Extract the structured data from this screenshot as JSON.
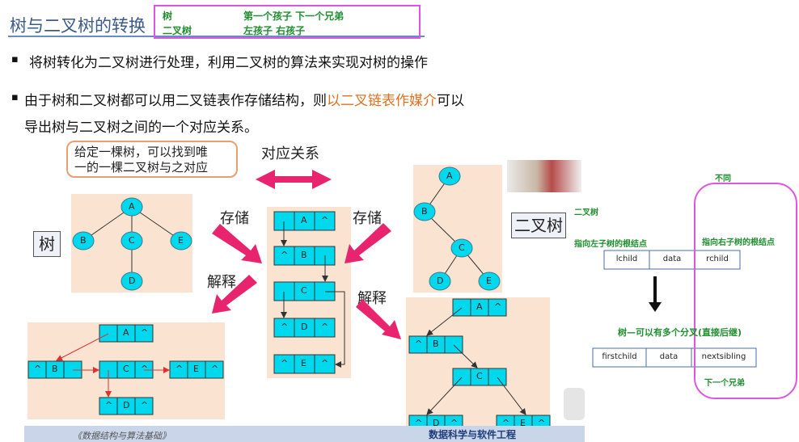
{
  "title": "树与二叉树的转换",
  "note": {
    "r1c1": "树",
    "r1c2": "第一个孩子 下一个兄弟",
    "r2c1": "二叉树",
    "r2c2": "左孩子 右孩子"
  },
  "bullets": {
    "b1": "将树转化为二叉树进行处理，利用二叉树的算法来实现对树的操作",
    "b2_a": "由于树和二叉树都可以用二叉链表作存储结构，则",
    "b2_hl": "以二叉链表作媒介",
    "b2_b": "可以",
    "b2_c": "导出树与二叉树之间的一个对应关系。",
    "bullet_glyph": "▪"
  },
  "diagram": {
    "callout_l1": "给定一棵树，可以找到唯",
    "callout_l2": "一的一棵二叉树与之对应",
    "correspondence": "对应关系",
    "store_left": "存储",
    "store_right": "存储",
    "interpret_left": "解释",
    "interpret_right": "解释",
    "tree_tag": "树",
    "bintree_tag": "二叉树",
    "null": "^",
    "nodes": {
      "a": "A",
      "b": "B",
      "c": "C",
      "d": "D",
      "e": "E"
    }
  },
  "right_notes": {
    "diff": "不同",
    "bintree": "二叉树",
    "left_root": "指向左子树的根结点",
    "right_root": "指向右子树的根结点",
    "lchild": "lchild",
    "data": "data",
    "rchild": "rchild",
    "tree_desc": "树—可以有多个分叉(直接后继)",
    "firstchild": "firstchild",
    "data2": "data",
    "nextsibling": "nextsibling",
    "next_sibling": "下一个兄弟"
  },
  "footer": {
    "book": "《数据结构与算法基础》",
    "school": "数据科学与软件工程"
  },
  "colors": {
    "node": "#00d8ee",
    "panel": "#fbe3d1",
    "arrow": "#e8246e",
    "green": "#1f8e2f",
    "magenta": "#e055e0"
  }
}
